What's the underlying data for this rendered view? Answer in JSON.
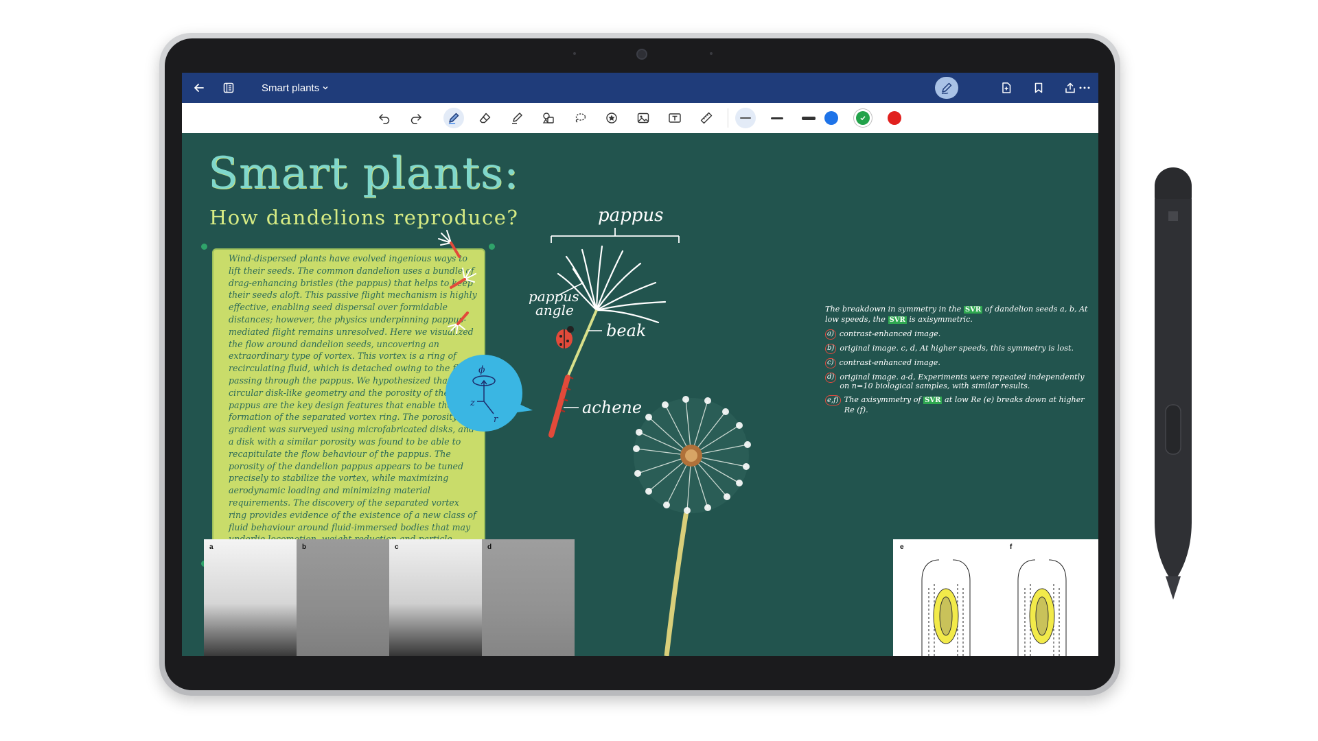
{
  "app": {
    "document_title": "Smart plants",
    "accent_color": "#1f3c7a"
  },
  "titlebar": {
    "buttons": [
      {
        "name": "back",
        "icon": "arrow-left-icon"
      },
      {
        "name": "pages",
        "icon": "notebook-icon"
      },
      {
        "name": "pen-mode",
        "icon": "pen-icon",
        "active": true
      },
      {
        "name": "add-page",
        "icon": "page-add-icon"
      },
      {
        "name": "bookmark",
        "icon": "bookmark-icon"
      },
      {
        "name": "share",
        "icon": "share-icon"
      },
      {
        "name": "more",
        "icon": "more-icon"
      }
    ]
  },
  "toolbar": {
    "tools": [
      "undo-icon",
      "redo-icon",
      "pen-icon",
      "eraser-icon",
      "highlighter-icon",
      "shapes-icon",
      "lasso-icon",
      "sticker-icon",
      "image-icon",
      "text-box-icon",
      "ruler-icon"
    ],
    "active_tool": "pen-icon",
    "stroke_widths": [
      "thin",
      "medium",
      "thick"
    ],
    "selected_width": "thin",
    "colors": [
      "#1e73e8",
      "#22a24a",
      "#e1201e"
    ],
    "selected_color": "#22a24a"
  },
  "canvas": {
    "title": "Smart plants:",
    "subtitle": "How dandelions reproduce?",
    "note_paragraph": "Wind-dispersed plants have evolved ingenious ways to lift their seeds. The common dandelion uses a bundle of drag-enhancing bristles (the pappus) that helps to keep their seeds aloft. This passive flight mechanism is highly effective, enabling seed dispersal over formidable distances; however, the physics underpinning pappus-mediated flight remains unresolved. Here we visualized the flow around dandelion seeds, uncovering an extraordinary type of vortex. This vortex is a ring of recirculating fluid, which is detached owing to the flow passing through the pappus. We hypothesized that the circular disk-like geometry and the porosity of the pappus are the key design features that enable the formation of the separated vortex ring. The porosity gradient was surveyed using microfabricated disks, and a disk with a similar porosity was found to be able to recapitulate the flow behaviour of the pappus. The porosity of the dandelion pappus appears to be tuned precisely to stabilize the vortex, while maximizing aerodynamic loading and minimizing material requirements. The discovery of the separated vortex ring provides evidence of the existence of a new class of fluid behaviour around fluid-immersed bodies that may underlie locomotion, weight reduction and particle retention in biological and manmade structures.",
    "diagram_labels": {
      "pappus": "pappus",
      "pappus_angle_1": "pappus",
      "pappus_angle_2": "angle",
      "beak": "beak",
      "achene": "achene",
      "axis_phi": "ϕ",
      "axis_z": "z",
      "axis_r": "r"
    },
    "right_notes": {
      "intro_1": "The breakdown in symmetry in the",
      "svr": "SVR",
      "intro_2": "of dandelion seeds a, b, At low speeds, the",
      "intro_3": "is axisymmetric.",
      "items": [
        {
          "marker": "a)",
          "text": "contrast-enhanced image."
        },
        {
          "marker": "b)",
          "text": "original image. c, d, At higher speeds, this symmetry is lost."
        },
        {
          "marker": "c)",
          "text": "contrast-enhanced image."
        },
        {
          "marker": "d)",
          "text": "original image. a-d, Experiments were repeated independently on n=10 biological samples, with similar results."
        },
        {
          "marker": "e,f)",
          "text_1": "The axisymmetry of",
          "text_2": "at low Re (e) breaks down at higher Re (f)."
        }
      ]
    },
    "figure_panels": [
      "a",
      "b",
      "c",
      "d"
    ],
    "figure_panels_right": [
      "e",
      "f"
    ]
  }
}
